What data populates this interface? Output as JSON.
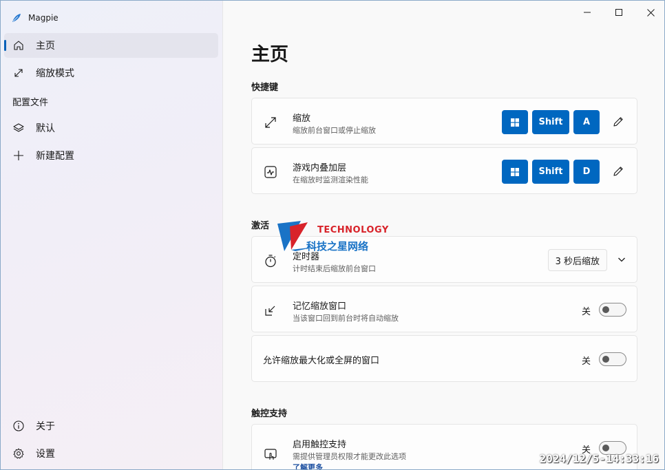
{
  "app": {
    "title": "Magpie"
  },
  "sidebar": {
    "items": [
      {
        "label": "主页",
        "icon": "home-icon"
      },
      {
        "label": "缩放模式",
        "icon": "scale-icon"
      }
    ],
    "section_label": "配置文件",
    "profiles": [
      {
        "label": "默认",
        "icon": "layers-icon"
      },
      {
        "label": "新建配置",
        "icon": "plus-icon"
      }
    ],
    "footer": [
      {
        "label": "关于",
        "icon": "info-icon"
      },
      {
        "label": "设置",
        "icon": "gear-icon"
      }
    ]
  },
  "main": {
    "page_title": "主页",
    "hotkeys": {
      "title": "快捷键",
      "items": [
        {
          "title": "缩放",
          "subtitle": "缩放前台窗口或停止缩放",
          "keys": [
            "Shift",
            "A"
          ]
        },
        {
          "title": "游戏内叠加层",
          "subtitle": "在缩放时监测渲染性能",
          "keys": [
            "Shift",
            "D"
          ]
        }
      ]
    },
    "activation": {
      "title": "激活",
      "timer": {
        "title": "定时器",
        "subtitle": "计时结束后缩放前台窗口",
        "value": "3 秒后缩放"
      },
      "remember": {
        "title": "记忆缩放窗口",
        "subtitle": "当该窗口回到前台时将自动缩放",
        "state": "关"
      },
      "allow_max": {
        "title": "允许缩放最大化或全屏的窗口",
        "state": "关"
      }
    },
    "touch": {
      "title": "触控支持",
      "enable": {
        "title": "启用触控支持",
        "subtitle": "需提供管理员权限才能更改此选项",
        "state": "关",
        "link": "了解更多"
      }
    }
  },
  "overlay": {
    "watermark_en": "TECHNOLOGY",
    "watermark_cn": "科技之星网络",
    "timestamp": "2024/12/5-14:33:16"
  },
  "colors": {
    "accent": "#0067c0",
    "nav_indicator": "#005fb8"
  }
}
